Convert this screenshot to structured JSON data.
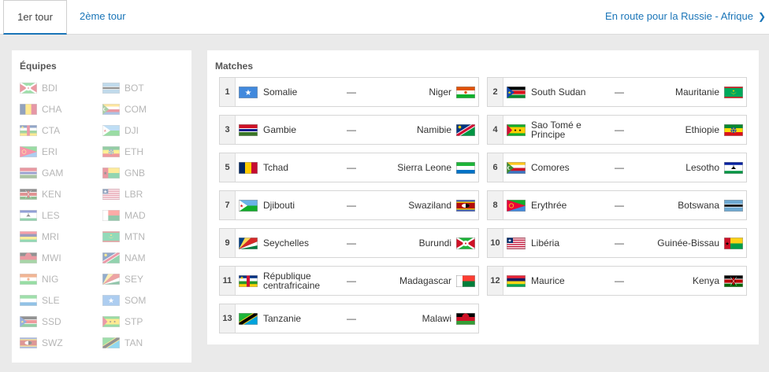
{
  "tabs": {
    "first_round": "1er tour",
    "second_round": "2ème tour",
    "route": "En route pour la Russie - Afrique"
  },
  "teams": {
    "title": "Équipes",
    "items": [
      {
        "code": "BDI",
        "flag": "BDI"
      },
      {
        "code": "BOT",
        "flag": "BOT"
      },
      {
        "code": "CHA",
        "flag": "CHA"
      },
      {
        "code": "COM",
        "flag": "COM"
      },
      {
        "code": "CTA",
        "flag": "CTA"
      },
      {
        "code": "DJI",
        "flag": "DJI"
      },
      {
        "code": "ERI",
        "flag": "ERI"
      },
      {
        "code": "ETH",
        "flag": "ETH"
      },
      {
        "code": "GAM",
        "flag": "GAM"
      },
      {
        "code": "GNB",
        "flag": "GNB"
      },
      {
        "code": "KEN",
        "flag": "KEN"
      },
      {
        "code": "LBR",
        "flag": "LBR"
      },
      {
        "code": "LES",
        "flag": "LES"
      },
      {
        "code": "MAD",
        "flag": "MAD"
      },
      {
        "code": "MRI",
        "flag": "MRI"
      },
      {
        "code": "MTN",
        "flag": "MTN"
      },
      {
        "code": "MWI",
        "flag": "MWI"
      },
      {
        "code": "NAM",
        "flag": "NAM"
      },
      {
        "code": "NIG",
        "flag": "NIG"
      },
      {
        "code": "SEY",
        "flag": "SEY"
      },
      {
        "code": "SLE",
        "flag": "SLE"
      },
      {
        "code": "SOM",
        "flag": "SOM"
      },
      {
        "code": "SSD",
        "flag": "SSD"
      },
      {
        "code": "STP",
        "flag": "STP"
      },
      {
        "code": "SWZ",
        "flag": "SWZ"
      },
      {
        "code": "TAN",
        "flag": "TAN"
      }
    ]
  },
  "matches": {
    "title": "Matches",
    "separator": "—",
    "items": [
      {
        "num": "1",
        "home": "Somalie",
        "home_flag": "SOM",
        "away": "Niger",
        "away_flag": "NIG"
      },
      {
        "num": "2",
        "home": "South Sudan",
        "home_flag": "SSD",
        "away": "Mauritanie",
        "away_flag": "MTN"
      },
      {
        "num": "3",
        "home": "Gambie",
        "home_flag": "GAM",
        "away": "Namibie",
        "away_flag": "NAM"
      },
      {
        "num": "4",
        "home": "Sao Tomé e Principe",
        "home_flag": "STP",
        "away": "Ethiopie",
        "away_flag": "ETH"
      },
      {
        "num": "5",
        "home": "Tchad",
        "home_flag": "CHA",
        "away": "Sierra Leone",
        "away_flag": "SLE"
      },
      {
        "num": "6",
        "home": "Comores",
        "home_flag": "COM",
        "away": "Lesotho",
        "away_flag": "LES"
      },
      {
        "num": "7",
        "home": "Djibouti",
        "home_flag": "DJI",
        "away": "Swaziland",
        "away_flag": "SWZ"
      },
      {
        "num": "8",
        "home": "Erythrée",
        "home_flag": "ERI",
        "away": "Botswana",
        "away_flag": "BOT"
      },
      {
        "num": "9",
        "home": "Seychelles",
        "home_flag": "SEY",
        "away": "Burundi",
        "away_flag": "BDI"
      },
      {
        "num": "10",
        "home": "Libéria",
        "home_flag": "LBR",
        "away": "Guinée-Bissau",
        "away_flag": "GNB"
      },
      {
        "num": "11",
        "home": "République centrafricaine",
        "home_flag": "CTA",
        "away": "Madagascar",
        "away_flag": "MAD"
      },
      {
        "num": "12",
        "home": "Maurice",
        "home_flag": "MRI",
        "away": "Kenya",
        "away_flag": "KEN"
      },
      {
        "num": "13",
        "home": "Tanzanie",
        "home_flag": "TAN",
        "away": "Malawi",
        "away_flag": "MWI"
      }
    ]
  }
}
